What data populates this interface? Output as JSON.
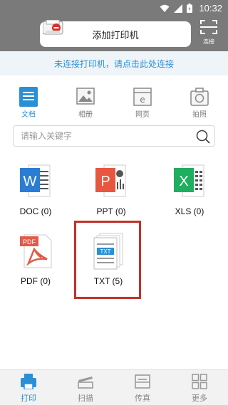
{
  "status_bar": {
    "time": "10:32"
  },
  "header": {
    "add_printer_label": "添加打印机",
    "scan_label": "连接"
  },
  "notice": {
    "text": "未连接打印机，请点击此处连接"
  },
  "tabs": [
    {
      "label": "文档",
      "icon": "document-icon",
      "active": true
    },
    {
      "label": "相册",
      "icon": "photo-album-icon",
      "active": false
    },
    {
      "label": "网页",
      "icon": "webpage-icon",
      "active": false
    },
    {
      "label": "拍照",
      "icon": "camera-icon",
      "active": false
    }
  ],
  "search": {
    "placeholder": "请输入关键字"
  },
  "files": [
    {
      "label": "DOC (0)",
      "icon": "word-doc-icon",
      "color": "#2b7cd3"
    },
    {
      "label": "PPT (0)",
      "icon": "ppt-icon",
      "color": "#e8563f"
    },
    {
      "label": "XLS (0)",
      "icon": "excel-icon",
      "color": "#1fae5f"
    },
    {
      "label": "PDF (0)",
      "icon": "pdf-icon",
      "color": "#e15a4a"
    },
    {
      "label": "TXT (5)",
      "icon": "txt-icon",
      "color": "#2b8fd6"
    }
  ],
  "bottom_nav": [
    {
      "label": "打印",
      "icon": "print-icon",
      "active": true
    },
    {
      "label": "扫描",
      "icon": "scan-icon",
      "active": false
    },
    {
      "label": "传真",
      "icon": "fax-icon",
      "active": false
    },
    {
      "label": "更多",
      "icon": "more-grid-icon",
      "active": false
    }
  ],
  "colors": {
    "accent": "#2b8fd6",
    "header_bg": "#7a7a7a",
    "highlight": "#c0322b"
  }
}
